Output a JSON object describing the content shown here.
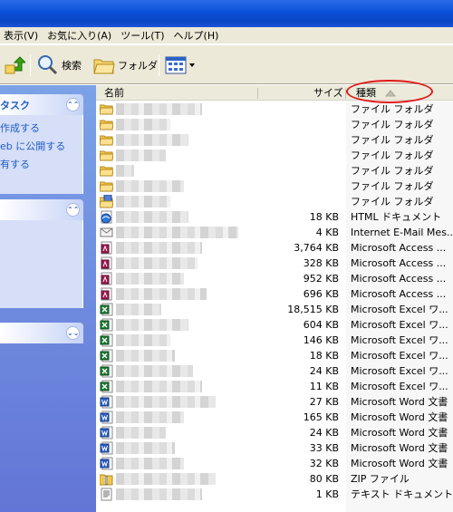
{
  "menu": [
    "表示(V)",
    "お気に入り(A)",
    "ツール(T)",
    "ヘルプ(H)"
  ],
  "toolbar": {
    "search_label": "検索",
    "folders_label": "フォルダ"
  },
  "taskpane": {
    "panel1_title": "タスク",
    "panel1_links": [
      "作成する",
      "eb に公開する",
      "有する"
    ]
  },
  "columns": {
    "name": "名前",
    "size": "サイズ",
    "type": "種類"
  },
  "files": [
    {
      "icon": "folder-icon",
      "size": "",
      "type": "ファイル フォルダ",
      "blur": 95
    },
    {
      "icon": "folder-icon",
      "size": "",
      "type": "ファイル フォルダ",
      "blur": 60
    },
    {
      "icon": "folder-icon",
      "size": "",
      "type": "ファイル フォルダ",
      "blur": 80
    },
    {
      "icon": "folder-icon",
      "size": "",
      "type": "ファイル フォルダ",
      "blur": 55
    },
    {
      "icon": "folder-icon",
      "size": "",
      "type": "ファイル フォルダ",
      "blur": 20
    },
    {
      "icon": "folder-icon",
      "size": "",
      "type": "ファイル フォルダ",
      "blur": 75
    },
    {
      "icon": "folder-special-icon",
      "size": "",
      "type": "ファイル フォルダ",
      "blur": 60
    },
    {
      "icon": "html-icon",
      "size": "18 KB",
      "type": "HTML ドキュメント",
      "blur": 80
    },
    {
      "icon": "email-icon",
      "size": "4 KB",
      "type": "Internet E-Mail Mes...",
      "blur": 135
    },
    {
      "icon": "access-icon",
      "size": "3,764 KB",
      "type": "Microsoft Access ...",
      "blur": 95
    },
    {
      "icon": "access-icon",
      "size": "328 KB",
      "type": "Microsoft Access ...",
      "blur": 90
    },
    {
      "icon": "access-icon",
      "size": "952 KB",
      "type": "Microsoft Access ...",
      "blur": 75
    },
    {
      "icon": "access-icon",
      "size": "696 KB",
      "type": "Microsoft Access ...",
      "blur": 100
    },
    {
      "icon": "excel-icon",
      "size": "18,515 KB",
      "type": "Microsoft Excel ワ...",
      "blur": 50
    },
    {
      "icon": "excel-icon",
      "size": "604 KB",
      "type": "Microsoft Excel ワ...",
      "blur": 80
    },
    {
      "icon": "excel-icon",
      "size": "146 KB",
      "type": "Microsoft Excel ワ...",
      "blur": 60
    },
    {
      "icon": "excel-icon",
      "size": "18 KB",
      "type": "Microsoft Excel ワ...",
      "blur": 65
    },
    {
      "icon": "excel-icon",
      "size": "24 KB",
      "type": "Microsoft Excel ワ...",
      "blur": 85
    },
    {
      "icon": "excel-icon",
      "size": "11 KB",
      "type": "Microsoft Excel ワ...",
      "blur": 95
    },
    {
      "icon": "word-icon",
      "size": "27 KB",
      "type": "Microsoft Word 文書",
      "blur": 110
    },
    {
      "icon": "word-icon",
      "size": "165 KB",
      "type": "Microsoft Word 文書",
      "blur": 75
    },
    {
      "icon": "word-icon",
      "size": "24 KB",
      "type": "Microsoft Word 文書",
      "blur": 55
    },
    {
      "icon": "word-icon",
      "size": "33 KB",
      "type": "Microsoft Word 文書",
      "blur": 65
    },
    {
      "icon": "word-icon",
      "size": "32 KB",
      "type": "Microsoft Word 文書",
      "blur": 75
    },
    {
      "icon": "zip-icon",
      "size": "80 KB",
      "type": "ZIP ファイル",
      "blur": 110
    },
    {
      "icon": "text-icon",
      "size": "1 KB",
      "type": "テキスト ドキュメント",
      "blur": 95
    }
  ]
}
